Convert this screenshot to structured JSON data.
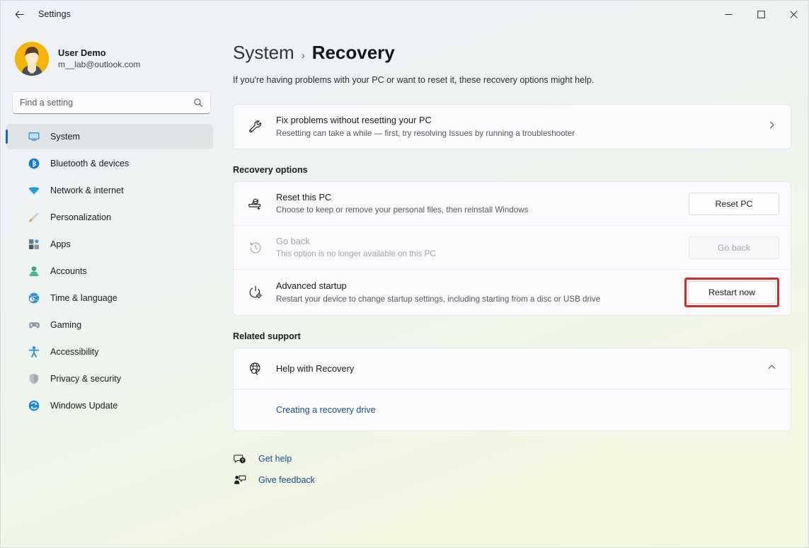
{
  "window": {
    "app_title": "Settings",
    "back_icon": "back-arrow-icon",
    "minimize_label": "—",
    "maximize_label": "□",
    "close_label": "✕"
  },
  "sidebar": {
    "profile": {
      "name": "User Demo",
      "email": "m__lab@outlook.com",
      "avatar_icon": "user-avatar"
    },
    "search": {
      "placeholder": "Find a setting",
      "value": "",
      "icon": "search-icon"
    },
    "items": [
      {
        "label": "System",
        "icon": "monitor-icon",
        "active": true
      },
      {
        "label": "Bluetooth & devices",
        "icon": "bluetooth-icon",
        "active": false
      },
      {
        "label": "Network & internet",
        "icon": "wifi-icon",
        "active": false
      },
      {
        "label": "Personalization",
        "icon": "paintbrush-icon",
        "active": false
      },
      {
        "label": "Apps",
        "icon": "apps-grid-icon",
        "active": false
      },
      {
        "label": "Accounts",
        "icon": "person-icon",
        "active": false
      },
      {
        "label": "Time & language",
        "icon": "clock-globe-icon",
        "active": false
      },
      {
        "label": "Gaming",
        "icon": "gamepad-icon",
        "active": false
      },
      {
        "label": "Accessibility",
        "icon": "accessibility-person-icon",
        "active": false
      },
      {
        "label": "Privacy & security",
        "icon": "shield-icon",
        "active": false
      },
      {
        "label": "Windows Update",
        "icon": "update-refresh-icon",
        "active": false
      }
    ]
  },
  "main": {
    "breadcrumb": {
      "parent": "System",
      "separator": "›",
      "current": "Recovery"
    },
    "page_description": "If you're having problems with your PC or want to reset it, these recovery options might help.",
    "fix_problems": {
      "title": "Fix problems without resetting your PC",
      "subtitle": "Resetting can take a while — first, try resolving Issues by running a troubleshooter",
      "icon": "wrench-icon",
      "chevron": "chevron-right-icon"
    },
    "recovery_options_heading": "Recovery options",
    "recovery_rows": [
      {
        "title": "Reset this PC",
        "subtitle": "Choose to keep or remove your personal files, then reinstall Windows",
        "icon": "reset-pc-icon",
        "button_label": "Reset PC",
        "disabled": false,
        "highlighted": false
      },
      {
        "title": "Go back",
        "subtitle": "This option is no longer available on this PC",
        "icon": "history-clock-icon",
        "button_label": "Go back",
        "disabled": true,
        "highlighted": false
      },
      {
        "title": "Advanced startup",
        "subtitle": "Restart your device to change startup settings, including starting from a disc or USB drive",
        "icon": "power-gear-icon",
        "button_label": "Restart now",
        "disabled": false,
        "highlighted": true
      }
    ],
    "related_support_heading": "Related support",
    "support": {
      "title": "Help with Recovery",
      "icon": "globe-search-icon",
      "chevron": "chevron-up-icon",
      "link": "Creating a recovery drive"
    },
    "footer": [
      {
        "label": "Get help",
        "icon": "help-question-icon"
      },
      {
        "label": "Give feedback",
        "icon": "feedback-icon"
      }
    ]
  },
  "colors": {
    "accent": "#0f6cbd",
    "highlight_red": "#d42a2a",
    "link": "#1a4a84",
    "avatar_bg": "#f2b705"
  }
}
